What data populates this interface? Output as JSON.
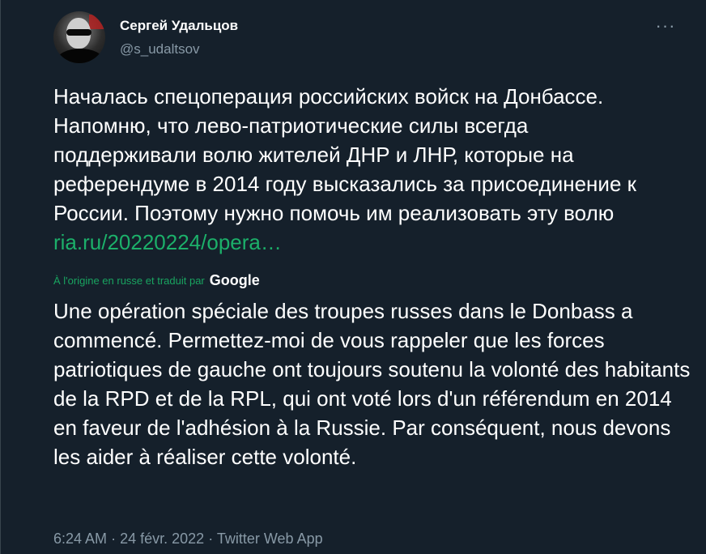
{
  "author": {
    "name": "Сергей Удальцов",
    "handle": "@s_udaltsov"
  },
  "menu": {
    "more_icon": "more-dots-icon",
    "more_label": "···"
  },
  "tweet": {
    "text_before_link": "Началась спецоперация российских войск на Донбассе. Напомню, что лево-патриотические силы всегда поддерживали волю жителей ДНР и ЛНР, которые на референдуме в 2014 году высказались за присоединение к России. Поэтому нужно помочь им реализовать эту волю ",
    "link_text": "ria.ru/20220224/opera…"
  },
  "translation": {
    "note": "À l'origine en russe et traduit par",
    "provider": "Google",
    "text": "Une opération spéciale des troupes russes dans le Donbass a commencé. Permettez-moi de vous rappeler que les forces patriotiques de gauche ont toujours soutenu la volonté des habitants de la RPD et de la RPL, qui ont voté lors d'un référendum en 2014 en faveur de l'adhésion à la Russie. Par conséquent, nous devons les aider à réaliser cette volonté."
  },
  "meta": {
    "time": "6:24 AM",
    "separator": "·",
    "date": "24 févr. 2022",
    "source": "Twitter Web App"
  },
  "colors": {
    "background": "#15202b",
    "text": "#ffffff",
    "secondary": "#8899a6",
    "link": "#1cb06a"
  }
}
